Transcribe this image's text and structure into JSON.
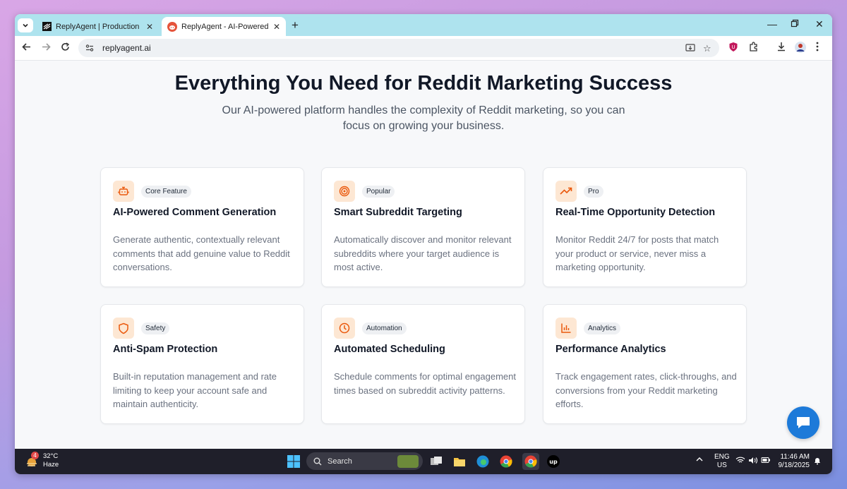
{
  "browser": {
    "tabs": [
      {
        "title": "ReplyAgent | Production | Sanit",
        "active": false
      },
      {
        "title": "ReplyAgent - AI-Powered Reddi",
        "active": true
      }
    ],
    "new_tab_label": "+",
    "url": "replyagent.ai"
  },
  "page": {
    "headline": "Everything You Need for Reddit Marketing Success",
    "subheadline": "Our AI-powered platform handles the complexity of Reddit marketing, so you can focus on growing your business.",
    "cards": [
      {
        "icon": "robot-icon",
        "badge": "Core Feature",
        "title": "AI-Powered Comment Generation",
        "description": "Generate authentic, contextually relevant comments that add genuine value to Reddit conversations."
      },
      {
        "icon": "target-icon",
        "badge": "Popular",
        "title": "Smart Subreddit Targeting",
        "description": "Automatically discover and monitor relevant subreddits where your target audience is most active."
      },
      {
        "icon": "trending-up-icon",
        "badge": "Pro",
        "title": "Real-Time Opportunity Detection",
        "description": "Monitor Reddit 24/7 for posts that match your product or service, never miss a marketing opportunity."
      },
      {
        "icon": "shield-icon",
        "badge": "Safety",
        "title": "Anti-Spam Protection",
        "description": "Built-in reputation management and rate limiting to keep your account safe and maintain authenticity."
      },
      {
        "icon": "clock-icon",
        "badge": "Automation",
        "title": "Automated Scheduling",
        "description": "Schedule comments for optimal engagement times based on subreddit activity patterns."
      },
      {
        "icon": "bar-chart-icon",
        "badge": "Analytics",
        "title": "Performance Analytics",
        "description": "Track engagement rates, click-throughs, and conversions from your Reddit marketing efforts."
      }
    ],
    "accent_color": "#ea580c",
    "icon_bg_color": "#fde7d3",
    "chat_button_color": "#1d7ad9"
  },
  "taskbar": {
    "weather_temp": "32°C",
    "weather_desc": "Haze",
    "weather_badge": "4",
    "search_placeholder": "Search",
    "lang_top": "ENG",
    "lang_bottom": "US",
    "time": "11:46 AM",
    "date": "9/18/2025"
  }
}
